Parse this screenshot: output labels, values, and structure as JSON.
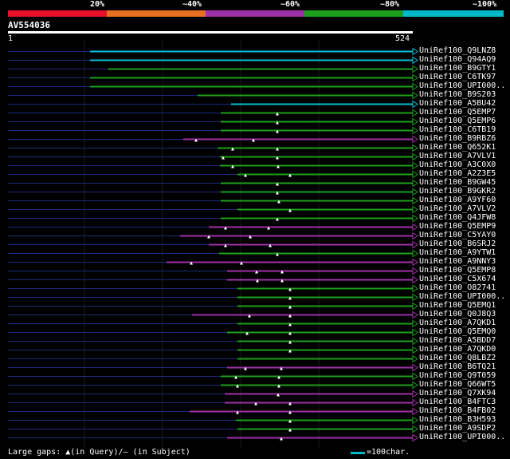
{
  "legend": {
    "colors": [
      "#e8102a",
      "#e87020",
      "#a030a8",
      "#1ca01c",
      "#00b8c8"
    ],
    "labels": [
      "20%",
      "~40%",
      "~60%",
      "~80%",
      "~100%"
    ]
  },
  "query": {
    "id": "AV554036",
    "start": "1",
    "end": "524"
  },
  "hits": [
    {
      "label": "UniRef100_Q9LNZ8",
      "color": "#00c0d8"
    },
    {
      "label": "UniRef100_Q94AQ9",
      "color": "#00c0d8"
    },
    {
      "label": "UniRef100_B9GTY1",
      "color": "#1ca01c"
    },
    {
      "label": "UniRef100_C6TK97",
      "color": "#1ca01c"
    },
    {
      "label": "UniRef100_UPI000..",
      "color": "#1ca01c"
    },
    {
      "label": "UniRef100_B9S203",
      "color": "#1ca01c"
    },
    {
      "label": "UniRef100_A5BU42",
      "color": "#00c0d8"
    },
    {
      "label": "UniRef100_Q5EMP7",
      "color": "#1ca01c"
    },
    {
      "label": "UniRef100_Q5EMP6",
      "color": "#1ca01c"
    },
    {
      "label": "UniRef100_C6TB19",
      "color": "#1ca01c"
    },
    {
      "label": "UniRef100_B9RBZ6",
      "color": "#a030a8"
    },
    {
      "label": "UniRef100_Q652K1",
      "color": "#1ca01c"
    },
    {
      "label": "UniRef100_A7VLV1",
      "color": "#1ca01c"
    },
    {
      "label": "UniRef100_A3C0X0",
      "color": "#1ca01c"
    },
    {
      "label": "UniRef100_A2Z3E5",
      "color": "#1ca01c"
    },
    {
      "label": "UniRef100_B9GW45",
      "color": "#1ca01c"
    },
    {
      "label": "UniRef100_B9GKR2",
      "color": "#1ca01c"
    },
    {
      "label": "UniRef100_A9YF60",
      "color": "#1ca01c"
    },
    {
      "label": "UniRef100_A7VLV2",
      "color": "#1ca01c"
    },
    {
      "label": "UniRef100_Q4JFW8",
      "color": "#1ca01c"
    },
    {
      "label": "UniRef100_Q5EMP9",
      "color": "#a030a8"
    },
    {
      "label": "UniRef100_C5YAY0",
      "color": "#a030a8"
    },
    {
      "label": "UniRef100_B6SRJ2",
      "color": "#a030a8"
    },
    {
      "label": "UniRef100_A9YTW1",
      "color": "#1ca01c"
    },
    {
      "label": "UniRef100_A9NNY3",
      "color": "#a030a8"
    },
    {
      "label": "UniRef100_Q5EMP8",
      "color": "#a030a8"
    },
    {
      "label": "UniRef100_C5X674",
      "color": "#a030a8"
    },
    {
      "label": "UniRef100_O82741",
      "color": "#1ca01c"
    },
    {
      "label": "UniRef100_UPI000..",
      "color": "#1ca01c"
    },
    {
      "label": "UniRef100_Q5EMQ1",
      "color": "#1ca01c"
    },
    {
      "label": "UniRef100_Q0J8Q3",
      "color": "#a030a8"
    },
    {
      "label": "UniRef100_A7QKD1",
      "color": "#1ca01c"
    },
    {
      "label": "UniRef100_Q5EMQ0",
      "color": "#1ca01c"
    },
    {
      "label": "UniRef100_A5BDD7",
      "color": "#1ca01c"
    },
    {
      "label": "UniRef100_A7QKD0",
      "color": "#1ca01c"
    },
    {
      "label": "UniRef100_Q8LBZ2",
      "color": "#1ca01c"
    },
    {
      "label": "UniRef100_B6TQ21",
      "color": "#a030a8"
    },
    {
      "label": "UniRef100_Q9T059",
      "color": "#1ca01c"
    },
    {
      "label": "UniRef100_Q66WT5",
      "color": "#1ca01c"
    },
    {
      "label": "UniRef100_Q7XK94",
      "color": "#a030a8"
    },
    {
      "label": "UniRef100_B4FTC3",
      "color": "#a030a8"
    },
    {
      "label": "UniRef100_B4FB02",
      "color": "#a030a8"
    },
    {
      "label": "UniRef100_B3H593",
      "color": "#1ca01c"
    },
    {
      "label": "UniRef100_A9SDP2",
      "color": "#1ca01c"
    },
    {
      "label": "UniRef100_UPI000..",
      "color": "#a030a8"
    }
  ],
  "footer": {
    "gaps_text": "Large gaps: ▲(in Query)/– (in Subject)",
    "scale_label": "=100char."
  }
}
